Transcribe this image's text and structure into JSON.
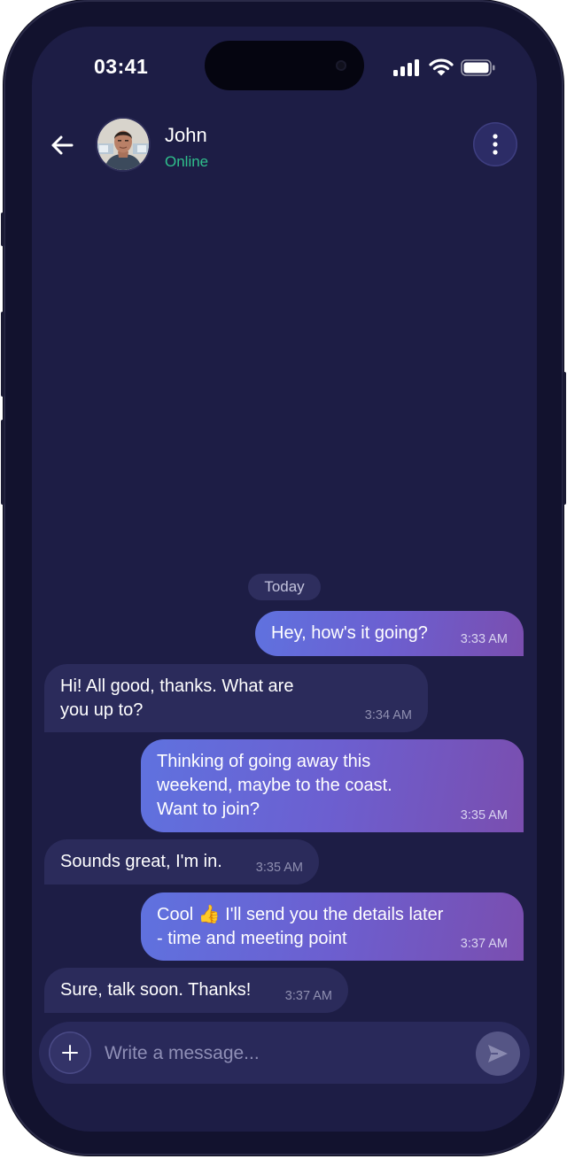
{
  "status_bar": {
    "time": "03:41"
  },
  "header": {
    "contact_name": "John",
    "contact_status": "Online",
    "back_icon": "arrow-left-icon",
    "more_icon": "more-vertical-icon"
  },
  "chat": {
    "date_separator": "Today",
    "messages": [
      {
        "direction": "outgoing",
        "text": "Hey, how's it going?",
        "time": "3:33 AM"
      },
      {
        "direction": "incoming",
        "text": "Hi! All good, thanks. What are you up to?",
        "time": "3:34 AM"
      },
      {
        "direction": "outgoing",
        "text": "Thinking of going away this weekend, maybe to the coast. Want to join?",
        "time": "3:35 AM"
      },
      {
        "direction": "incoming",
        "text": "Sounds great, I'm in.",
        "time": "3:35 AM"
      },
      {
        "direction": "outgoing",
        "text_before_emoji": "Cool",
        "emoji": "👍",
        "text_after_emoji": "I'll send you the details later - time and meeting point",
        "time": "3:37 AM"
      },
      {
        "direction": "incoming",
        "text": "Sure, talk soon. Thanks!",
        "time": "3:37 AM"
      }
    ]
  },
  "composer": {
    "placeholder": "Write a message...",
    "value": "",
    "add_icon": "plus-icon",
    "send_icon": "send-icon"
  },
  "colors": {
    "screen_bg": "#1d1d45",
    "online": "#2fc08c",
    "incoming_bubble": "#2b2b5b",
    "outgoing_gradient_start": "#5f72df",
    "outgoing_gradient_end": "#7a4eaf"
  }
}
